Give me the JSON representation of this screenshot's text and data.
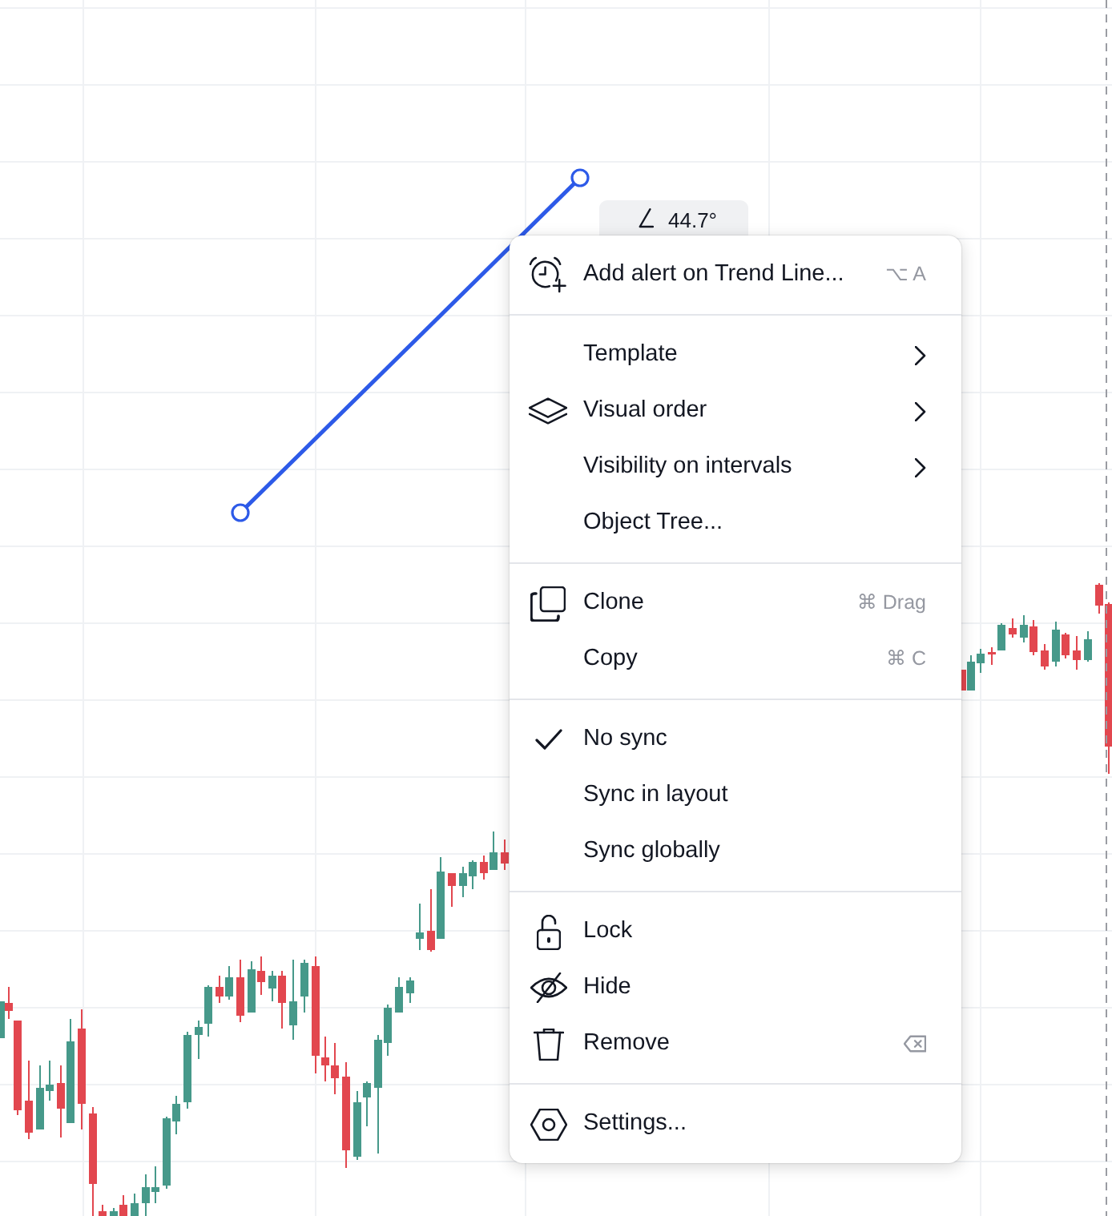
{
  "chart": {
    "angle_label": "44.7°"
  },
  "context_menu": {
    "sections": [
      {
        "items": [
          {
            "label": "Add alert on Trend Line...",
            "shortcut": "⌥ A"
          }
        ]
      },
      {
        "items": [
          {
            "label": "Template",
            "submenu": true
          },
          {
            "label": "Visual order",
            "submenu": true
          },
          {
            "label": "Visibility on intervals",
            "submenu": true
          },
          {
            "label": "Object Tree...",
            "submenu": false
          }
        ]
      },
      {
        "items": [
          {
            "label": "Clone",
            "shortcut": "⌘ Drag"
          },
          {
            "label": "Copy",
            "shortcut": "⌘ C"
          }
        ]
      },
      {
        "items": [
          {
            "label": "No sync",
            "checked": true
          },
          {
            "label": "Sync in layout",
            "checked": false
          },
          {
            "label": "Sync globally",
            "checked": false
          }
        ]
      },
      {
        "items": [
          {
            "label": "Lock"
          },
          {
            "label": "Hide"
          },
          {
            "label": "Remove"
          }
        ]
      },
      {
        "items": [
          {
            "label": "Settings..."
          }
        ]
      }
    ]
  }
}
